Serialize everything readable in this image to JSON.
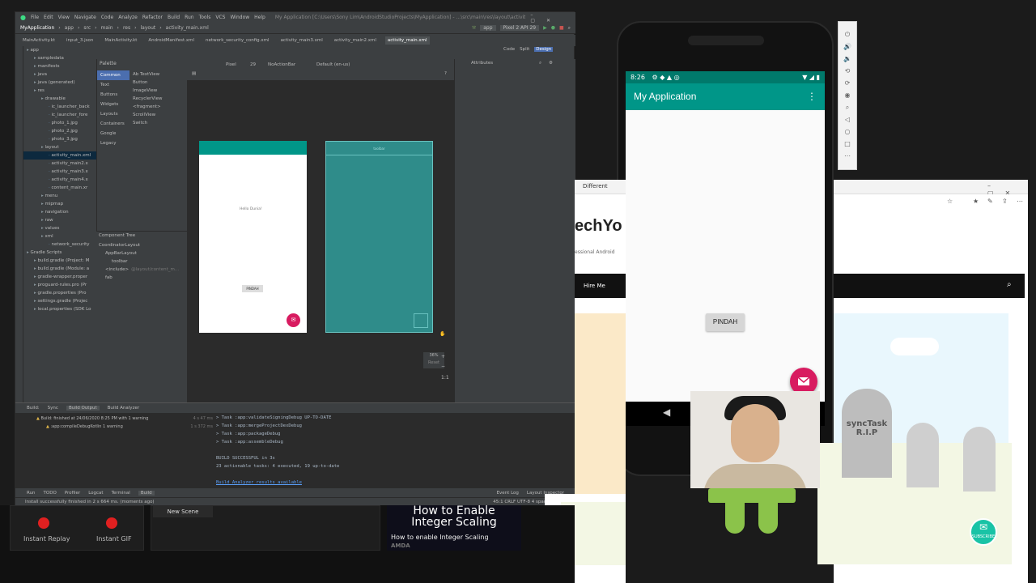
{
  "ide": {
    "menu": [
      "File",
      "Edit",
      "View",
      "Navigate",
      "Code",
      "Analyze",
      "Refactor",
      "Build",
      "Run",
      "Tools",
      "VCS",
      "Window",
      "Help"
    ],
    "window_title": "My Application [C:\\Users\\Sony Lim\\AndroidStudioProjects\\MyApplication] - ...\\src\\main\\res\\layout\\activity_main.xml [app]",
    "breadcrumb": [
      "MyApplication",
      "app",
      "src",
      "main",
      "res",
      "layout",
      "activity_main.xml"
    ],
    "run_config": "app",
    "device": "Pixel 2 API 29",
    "tabs": [
      "MainActivity.kt",
      "input_3.json",
      "MainActivity.kt",
      "AndroidManifest.xml",
      "network_security_config.xml",
      "activity_main3.xml",
      "activity_main2.xml",
      "activity_main.xml"
    ],
    "view_modes": [
      "Code",
      "Split",
      "Design"
    ],
    "project_tree": [
      {
        "label": "app",
        "indent": 0
      },
      {
        "label": "sampledata",
        "indent": 1
      },
      {
        "label": "manifests",
        "indent": 1
      },
      {
        "label": "java",
        "indent": 1
      },
      {
        "label": "java (generated)",
        "indent": 1
      },
      {
        "label": "res",
        "indent": 1
      },
      {
        "label": "drawable",
        "indent": 2
      },
      {
        "label": "ic_launcher_back",
        "indent": 3
      },
      {
        "label": "ic_launcher_fore",
        "indent": 3
      },
      {
        "label": "photo_1.jpg",
        "indent": 3
      },
      {
        "label": "photo_2.jpg",
        "indent": 3
      },
      {
        "label": "photo_3.jpg",
        "indent": 3
      },
      {
        "label": "layout",
        "indent": 2
      },
      {
        "label": "activity_main.xml",
        "indent": 3,
        "selected": true
      },
      {
        "label": "activity_main2.x",
        "indent": 3
      },
      {
        "label": "activity_main3.x",
        "indent": 3
      },
      {
        "label": "activity_main4.x",
        "indent": 3
      },
      {
        "label": "content_main.xr",
        "indent": 3
      },
      {
        "label": "menu",
        "indent": 2
      },
      {
        "label": "mipmap",
        "indent": 2
      },
      {
        "label": "navigation",
        "indent": 2
      },
      {
        "label": "raw",
        "indent": 2
      },
      {
        "label": "values",
        "indent": 2
      },
      {
        "label": "xml",
        "indent": 2
      },
      {
        "label": "network_security",
        "indent": 3
      },
      {
        "label": "Gradle Scripts",
        "indent": 0
      },
      {
        "label": "build.gradle (Project: M",
        "indent": 1
      },
      {
        "label": "build.gradle (Module: a",
        "indent": 1
      },
      {
        "label": "gradle-wrapper.proper",
        "indent": 1
      },
      {
        "label": "proguard-rules.pro (Pr",
        "indent": 1
      },
      {
        "label": "gradle.properties (Pro",
        "indent": 1
      },
      {
        "label": "settings.gradle (Projec",
        "indent": 1
      },
      {
        "label": "local.properties (SDK Lo",
        "indent": 1
      }
    ],
    "palette": {
      "title": "Palette",
      "categories": [
        "Common",
        "Text",
        "Buttons",
        "Widgets",
        "Layouts",
        "Containers",
        "Google",
        "Legacy"
      ],
      "items": [
        "Ab TextView",
        "Button",
        "ImageView",
        "RecyclerView",
        "<fragment>",
        "ScrollView",
        "Switch"
      ]
    },
    "design_toolbar": {
      "device": "Pixel",
      "api": "29",
      "theme": "NoActionBar",
      "locale": "Default (en-us)"
    },
    "attributes_title": "Attributes",
    "component_tree": {
      "title": "Component Tree",
      "items": [
        {
          "label": "CoordinatorLayout",
          "indent": 0
        },
        {
          "label": "AppBarLayout",
          "indent": 1
        },
        {
          "label": "toolbar",
          "indent": 2
        },
        {
          "label": "<include>",
          "hint": "@layout/content_m...",
          "indent": 1
        },
        {
          "label": "fab",
          "indent": 1
        }
      ]
    },
    "preview": {
      "hello": "Hello Dunia!",
      "button": "PINDAH",
      "blueprint_label": "toolbar"
    },
    "zoom": {
      "value": "36%",
      "label": "Reset"
    },
    "build": {
      "tabs": [
        "Build:",
        "Sync",
        "Build Output",
        "Build Analyzer"
      ],
      "tree": [
        {
          "label": "Build: finished at 24/06/2020 8:25 PM with 1 warning",
          "time": "4 s 47 ms"
        },
        {
          "label": ":app:compileDebugKotlin  1 warning",
          "time": "1 s 372 ms"
        }
      ],
      "console": [
        "> Task :app:validateSigningDebug UP-TO-DATE",
        "> Task :app:mergeProjectDexDebug",
        "> Task :app:packageDebug",
        "> Task :app:assembleDebug",
        "",
        "BUILD SUCCESSFUL in 3s",
        "23 actionable tasks: 4 executed, 19 up-to-date",
        "",
        "Build Analyzer results available"
      ]
    },
    "bottom_tools": [
      "Run",
      "TODO",
      "Profiler",
      "Logcat",
      "Terminal",
      "Build"
    ],
    "bottom_right_tools": [
      "Event Log",
      "Layout Inspector"
    ],
    "status": "Install successfully finished in 2 s 664 ms. (moments ago)",
    "status_right": "45:1  CRLF  UTF-8  4 spaces"
  },
  "emulator": {
    "time": "8:26",
    "app_title": "My Application",
    "button": "PINDAH"
  },
  "browser": {
    "tab_title": "Different",
    "site_heading": "echYo",
    "site_sub": "essional Android",
    "nav_item": "Hire Me",
    "tombstone_text": "syncTask\nR.I.P",
    "subscribe": "SUBSCRIBE"
  },
  "obs": {
    "replay": "Instant Replay",
    "gif": "Instant GIF",
    "scene": "New Scene",
    "promo_title": "How to Enable\nInteger Scaling",
    "promo_caption": "How to enable Integer Scaling",
    "brand": "AMDA"
  },
  "colors": {
    "primary": "#009688",
    "primary_dark": "#00796b",
    "accent": "#d81b60"
  }
}
